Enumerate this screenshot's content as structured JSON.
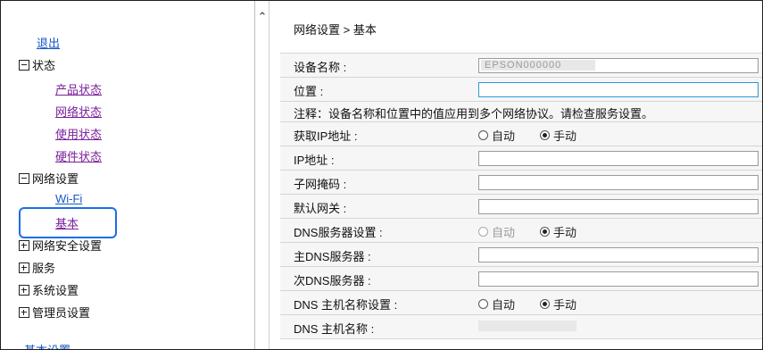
{
  "sidebar": {
    "logout": "退出",
    "status_section": "状态",
    "status_items": [
      "产品状态",
      "网络状态",
      "使用状态",
      "硬件状态"
    ],
    "network_section": "网络设置",
    "network_items": [
      "Wi-Fi",
      "基本"
    ],
    "sections": [
      "网络安全设置",
      "服务",
      "系统设置",
      "管理员设置"
    ],
    "bottom_link": "基本设置"
  },
  "content": {
    "breadcrumb": "网络设置 > 基本",
    "device_name_label": "设备名称 :",
    "device_name_value": "EPSON000000",
    "location_label": "位置 :",
    "note": "注释：设备名称和位置中的值应用到多个网络协议。请检查服务设置。",
    "get_ip_label": "获取IP地址 :",
    "ip_label": "IP地址 :",
    "subnet_label": "子网掩码 :",
    "gateway_label": "默认网关 :",
    "dns_setting_label": "DNS服务器设置 :",
    "primary_dns_label": "主DNS服务器 :",
    "secondary_dns_label": "次DNS服务器 :",
    "dns_host_setting_label": "DNS 主机名称设置 :",
    "dns_host_label": "DNS 主机名称 :",
    "auto": "自动",
    "manual": "手动"
  }
}
